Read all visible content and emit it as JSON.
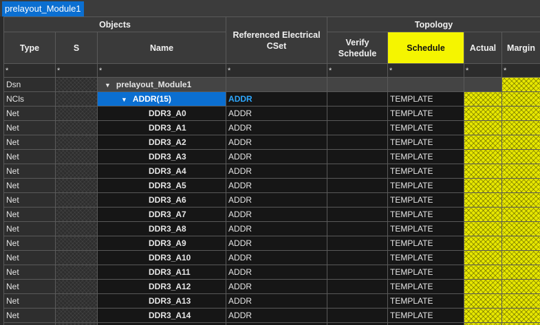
{
  "tab": {
    "label": "prelayout_Module1"
  },
  "headers": {
    "objects": "Objects",
    "topology": "Topology",
    "type": "Type",
    "s": "S",
    "name": "Name",
    "ref_cset": "Referenced Electrical CSet",
    "verify_schedule": "Verify Schedule",
    "schedule": "Schedule",
    "actual": "Actual",
    "margin": "Margin",
    "filter": "*"
  },
  "colors": {
    "highlight": "#f5f500",
    "selection": "#0b6fd1",
    "cset_link": "#2ea8ff"
  },
  "rows": [
    {
      "type": "Dsn",
      "name": "prelayout_Module1",
      "cset": "",
      "schedule": ""
    },
    {
      "type": "NCls",
      "name": "ADDR(15)",
      "cset": "ADDR",
      "schedule": "TEMPLATE"
    },
    {
      "type": "Net",
      "name": "DDR3_A0",
      "cset": "ADDR",
      "schedule": "TEMPLATE"
    },
    {
      "type": "Net",
      "name": "DDR3_A1",
      "cset": "ADDR",
      "schedule": "TEMPLATE"
    },
    {
      "type": "Net",
      "name": "DDR3_A2",
      "cset": "ADDR",
      "schedule": "TEMPLATE"
    },
    {
      "type": "Net",
      "name": "DDR3_A3",
      "cset": "ADDR",
      "schedule": "TEMPLATE"
    },
    {
      "type": "Net",
      "name": "DDR3_A4",
      "cset": "ADDR",
      "schedule": "TEMPLATE"
    },
    {
      "type": "Net",
      "name": "DDR3_A5",
      "cset": "ADDR",
      "schedule": "TEMPLATE"
    },
    {
      "type": "Net",
      "name": "DDR3_A6",
      "cset": "ADDR",
      "schedule": "TEMPLATE"
    },
    {
      "type": "Net",
      "name": "DDR3_A7",
      "cset": "ADDR",
      "schedule": "TEMPLATE"
    },
    {
      "type": "Net",
      "name": "DDR3_A8",
      "cset": "ADDR",
      "schedule": "TEMPLATE"
    },
    {
      "type": "Net",
      "name": "DDR3_A9",
      "cset": "ADDR",
      "schedule": "TEMPLATE"
    },
    {
      "type": "Net",
      "name": "DDR3_A10",
      "cset": "ADDR",
      "schedule": "TEMPLATE"
    },
    {
      "type": "Net",
      "name": "DDR3_A11",
      "cset": "ADDR",
      "schedule": "TEMPLATE"
    },
    {
      "type": "Net",
      "name": "DDR3_A12",
      "cset": "ADDR",
      "schedule": "TEMPLATE"
    },
    {
      "type": "Net",
      "name": "DDR3_A13",
      "cset": "ADDR",
      "schedule": "TEMPLATE"
    },
    {
      "type": "Net",
      "name": "DDR3_A14",
      "cset": "ADDR",
      "schedule": "TEMPLATE"
    },
    {
      "type": "Net",
      "name": "",
      "cset": "",
      "schedule": ""
    }
  ]
}
